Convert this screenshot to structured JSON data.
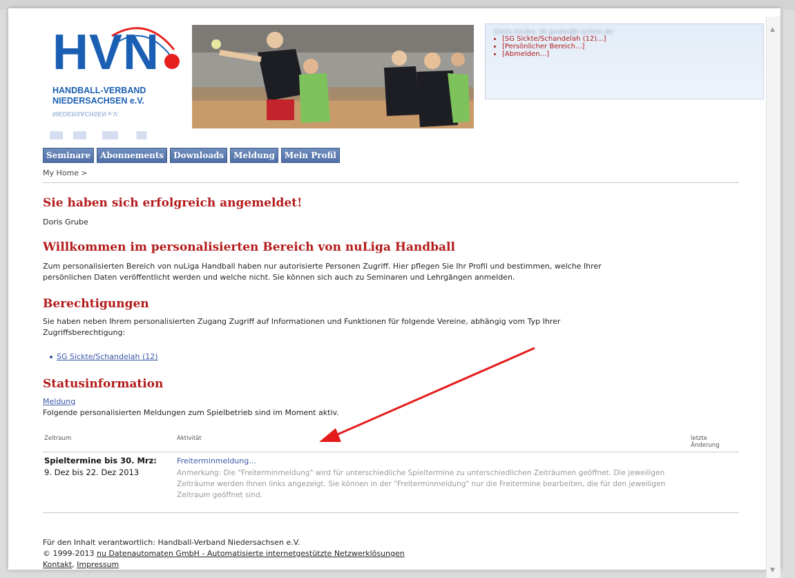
{
  "userbox": {
    "name_blurred": "Doris Grube, dt.grube@t-online.de",
    "items": [
      {
        "label": "[SG Sickte/Schandelah (12)...]"
      },
      {
        "label": "[Persönlicher Bereich...]"
      },
      {
        "label": "[Abmelden...]"
      }
    ]
  },
  "logo": {
    "abbr": "HVN",
    "line1": "HANDBALL-VERBAND",
    "line2": "NIEDERSACHSEN e.V.",
    "mirror": "NIEDERSACHSEN e.V."
  },
  "nav": {
    "items": [
      {
        "label": "Seminare"
      },
      {
        "label": "Abonnements"
      },
      {
        "label": "Downloads"
      },
      {
        "label": "Meldung"
      },
      {
        "label": "Mein Profil"
      }
    ]
  },
  "breadcrumb": "My Home >",
  "success": {
    "heading": "Sie haben sich erfolgreich angemeldet!",
    "user": "Doris Grube"
  },
  "welcome": {
    "heading": "Willkommen im personalisierten Bereich von nuLiga Handball",
    "line1": "Zum personalisierten Bereich von nuLiga Handball haben nur autorisierte Personen Zugriff. Hier pflegen Sie Ihr Profil und bestimmen, welche Ihrer",
    "line2": "persönlichen Daten veröffentlicht werden und welche nicht. Sie können sich auch zu Seminaren und Lehrgängen anmelden."
  },
  "permissions": {
    "heading": "Berechtigungen",
    "line1": "Sie haben neben Ihrem personalisierten Zugang Zugriff auf Informationen und Funktionen für folgende Vereine, abhängig vom Typ Ihrer",
    "line2": "Zugriffsberechtigung:",
    "club_link": "SG Sickte/Schandelah (12)"
  },
  "status": {
    "heading": "Statusinformation",
    "link": "Meldung",
    "text": "Folgende personalisierten Meldungen zum Spielbetrieb sind im Moment aktiv.",
    "columns": {
      "period": "Zeitraum",
      "activity": "Aktivität",
      "changed_1": "letzte",
      "changed_2": "Änderung"
    },
    "row": {
      "period_title": "Spieltermine bis 30. Mrz:",
      "period_range": "9. Dez bis 22. Dez 2013",
      "activity_link": "Freiterminmeldung...",
      "note": "Anmerkung: Die \"Freiterminmeldung\" wird für unterschiedliche Spieltermine zu unterschiedlichen Zeiträumen geöffnet. Die jeweiligen Zeiträume werden Ihnen links angezeigt. Sie können in der \"Freiterminmeldung\" nur die Freitermine bearbeiten, die für den jeweiligen Zeitraum geöffnet sind."
    }
  },
  "footer": {
    "responsible": "Für den Inhalt verantwortlich: Handball-Verband Niedersachsen e.V.",
    "copyright_prefix": "© 1999-2013",
    "copyright_link": "nu Datenautomaten GmbH - Automatisierte internetgestützte Netzwerklösungen",
    "contact": "Kontakt",
    "imprint": "Impressum"
  },
  "colors": {
    "heading_red": "#b41a1a",
    "nav_blue": "#4e6ea5",
    "link_blue": "#3a56a8",
    "annotation_arrow": "#e41b1b"
  }
}
